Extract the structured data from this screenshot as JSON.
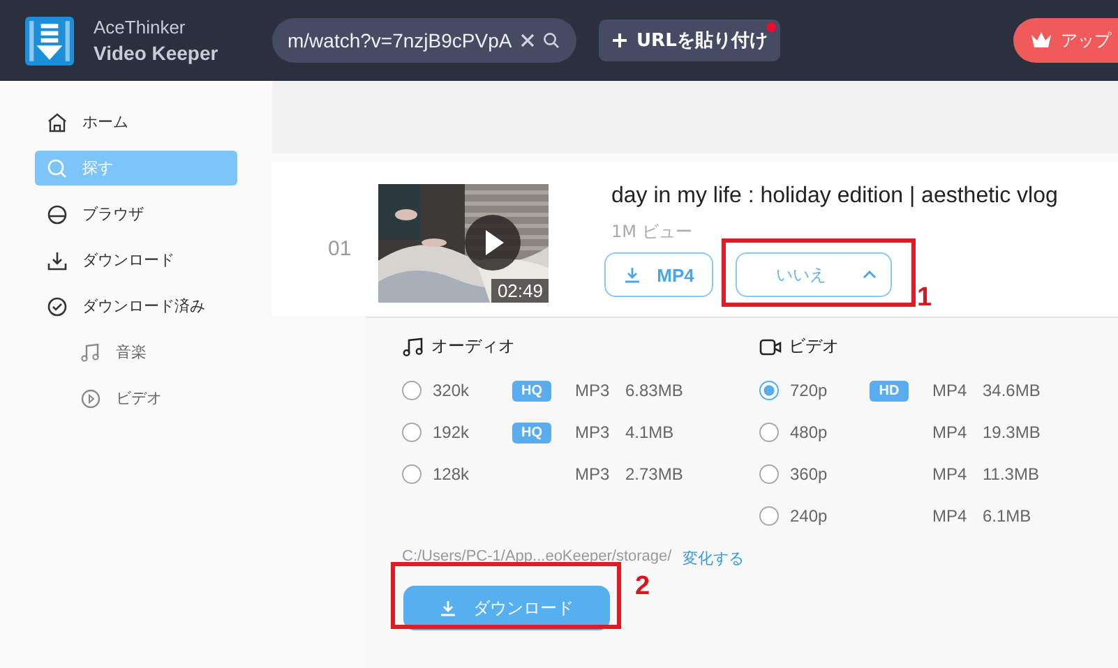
{
  "header": {
    "logo": [
      "AceThinker",
      "Video Keeper"
    ],
    "search": {
      "value": "m/watch?v=7nzjB9cPVpA"
    },
    "paste_button": {
      "label": "URLを貼り付け",
      "notification": true
    },
    "upgrade_button": {
      "label": "アップ"
    }
  },
  "sidebar": {
    "items": [
      {
        "label": "ホーム",
        "kind": "home",
        "selected": false
      },
      {
        "label": "探す",
        "kind": "search",
        "selected": true
      },
      {
        "label": "ブラウザ",
        "kind": "browser",
        "selected": false
      },
      {
        "label": "ダウンロード",
        "kind": "download",
        "selected": false
      },
      {
        "label": "ダウンロード済み",
        "kind": "done",
        "selected": false,
        "children": [
          {
            "label": "音楽",
            "kind": "music",
            "selected": false
          },
          {
            "label": "ビデオ",
            "kind": "video",
            "selected": false
          }
        ]
      }
    ]
  },
  "video": {
    "index": "01",
    "title": "day in my life : holiday edition | aesthetic vlog",
    "views": "1M ビュー",
    "duration": "02:49",
    "format_button": "MP4",
    "dropdown": {
      "label": "いいえ",
      "expanded": true
    }
  },
  "audio": {
    "heading": "オーディオ",
    "options": [
      {
        "quality": "320k",
        "badge": "HQ",
        "format": "MP3",
        "size": "6.83MB",
        "selected": false
      },
      {
        "quality": "192k",
        "badge": "HQ",
        "format": "MP3",
        "size": "4.1MB",
        "selected": false
      },
      {
        "quality": "128k",
        "format": "MP3",
        "size": "2.73MB",
        "selected": false
      }
    ]
  },
  "video_formats": {
    "heading": "ビデオ",
    "options": [
      {
        "quality": "720p",
        "badge": "HD",
        "format": "MP4",
        "size": "34.6MB",
        "selected": true
      },
      {
        "quality": "480p",
        "format": "MP4",
        "size": "19.3MB",
        "selected": false
      },
      {
        "quality": "360p",
        "format": "MP4",
        "size": "11.3MB",
        "selected": false
      },
      {
        "quality": "240p",
        "format": "MP4",
        "size": "6.1MB",
        "selected": false
      }
    ]
  },
  "save_path": "C:/Users/PC-1/App...eoKeeper/storage/",
  "change_link": "変化する",
  "download_button": "ダウンロード",
  "annotations": [
    {
      "label": "1"
    },
    {
      "label": "2"
    }
  ]
}
